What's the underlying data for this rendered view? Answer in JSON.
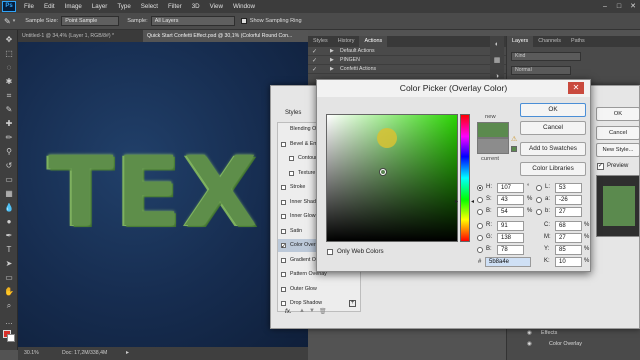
{
  "menubar": {
    "logo": "Ps",
    "items": [
      "File",
      "Edit",
      "Image",
      "Layer",
      "Type",
      "Select",
      "Filter",
      "3D",
      "View",
      "Window"
    ],
    "window_controls": [
      "–",
      "□",
      "✕"
    ]
  },
  "options": {
    "sample_size_label": "Sample Size:",
    "sample_size_value": "Point Sample",
    "sample_label": "Sample:",
    "sample_value": "All Layers",
    "sampling_ring_label": "Show Sampling Ring"
  },
  "doctabs": [
    {
      "label": "Untitled-1 @ 34,4% (Layer 1, RGB/8#) *",
      "active": false
    },
    {
      "label": "Quick Start Confetti Effect.psd @ 30,1% (Colorful Round Con...",
      "active": true
    }
  ],
  "canvas": {
    "headline": "TEX"
  },
  "statusbar": {
    "zoom": "30.1%",
    "doc": "Doc: 17,2M/338,4M"
  },
  "actions_panel": {
    "tabs": [
      {
        "label": "Styles",
        "active": false
      },
      {
        "label": "History",
        "active": false
      },
      {
        "label": "Actions",
        "active": true
      }
    ],
    "rows": [
      "Default Actions",
      "PINGEN",
      "Confetti Actions"
    ]
  },
  "layers_panel": {
    "tabs": [
      {
        "label": "Layers",
        "active": true
      },
      {
        "label": "Channels",
        "active": false
      },
      {
        "label": "Paths",
        "active": false
      }
    ],
    "kind_placeholder": "Kind",
    "blend_mode": "Normal",
    "rows": [
      "Effects",
      "Color Overlay"
    ]
  },
  "layer_style": {
    "header": "Styles",
    "items": [
      {
        "label": "Blending Options",
        "checkbox": false,
        "checked": false,
        "plus": false,
        "selected": false
      },
      {
        "label": "Bevel & Emboss",
        "checkbox": true,
        "checked": false,
        "plus": false,
        "selected": false
      },
      {
        "label": "Contour",
        "checkbox": true,
        "checked": false,
        "plus": false,
        "selected": false,
        "indent": true
      },
      {
        "label": "Texture",
        "checkbox": true,
        "checked": false,
        "plus": false,
        "selected": false,
        "indent": true
      },
      {
        "label": "Stroke",
        "checkbox": true,
        "checked": false,
        "plus": true,
        "selected": false
      },
      {
        "label": "Inner Shadow",
        "checkbox": true,
        "checked": false,
        "plus": true,
        "selected": false
      },
      {
        "label": "Inner Glow",
        "checkbox": true,
        "checked": false,
        "plus": false,
        "selected": false
      },
      {
        "label": "Satin",
        "checkbox": true,
        "checked": false,
        "plus": false,
        "selected": false
      },
      {
        "label": "Color Overlay",
        "checkbox": true,
        "checked": true,
        "plus": true,
        "selected": true
      },
      {
        "label": "Gradient Overlay",
        "checkbox": true,
        "checked": false,
        "plus": true,
        "selected": false
      },
      {
        "label": "Pattern Overlay",
        "checkbox": true,
        "checked": false,
        "plus": false,
        "selected": false
      },
      {
        "label": "Outer Glow",
        "checkbox": true,
        "checked": false,
        "plus": false,
        "selected": false
      },
      {
        "label": "Drop Shadow",
        "checkbox": true,
        "checked": false,
        "plus": true,
        "selected": false
      }
    ],
    "buttons": [
      "OK",
      "Cancel",
      "New Style...",
      "Preview"
    ],
    "fx_label": "fx."
  },
  "color_picker": {
    "title": "Color Picker (Overlay Color)",
    "close": "✕",
    "new_label": "new",
    "current_label": "current",
    "new_color": "#5b8a4e",
    "current_color": "#8c8c8c",
    "hue_color": "#2bd404",
    "buttons": {
      "ok": "OK",
      "cancel": "Cancel",
      "add_swatches": "Add to Swatches",
      "color_libraries": "Color Libraries"
    },
    "only_web_colors": "Only Web Colors",
    "hsb": [
      {
        "label": "H:",
        "value": "107",
        "unit": "°",
        "selected": true
      },
      {
        "label": "S:",
        "value": "43",
        "unit": "%",
        "selected": false
      },
      {
        "label": "B:",
        "value": "54",
        "unit": "%",
        "selected": false
      }
    ],
    "rgb": [
      {
        "label": "R:",
        "value": "91"
      },
      {
        "label": "G:",
        "value": "138"
      },
      {
        "label": "B:",
        "value": "78"
      }
    ],
    "lab": [
      {
        "label": "L:",
        "value": "53"
      },
      {
        "label": "a:",
        "value": "-26"
      },
      {
        "label": "b:",
        "value": "27"
      }
    ],
    "cmyk": [
      {
        "label": "C:",
        "value": "68",
        "unit": "%"
      },
      {
        "label": "M:",
        "value": "27",
        "unit": "%"
      },
      {
        "label": "Y:",
        "value": "85",
        "unit": "%"
      },
      {
        "label": "K:",
        "value": "10",
        "unit": "%"
      }
    ],
    "hex_label": "#",
    "hex_value": "5b8a4e"
  }
}
